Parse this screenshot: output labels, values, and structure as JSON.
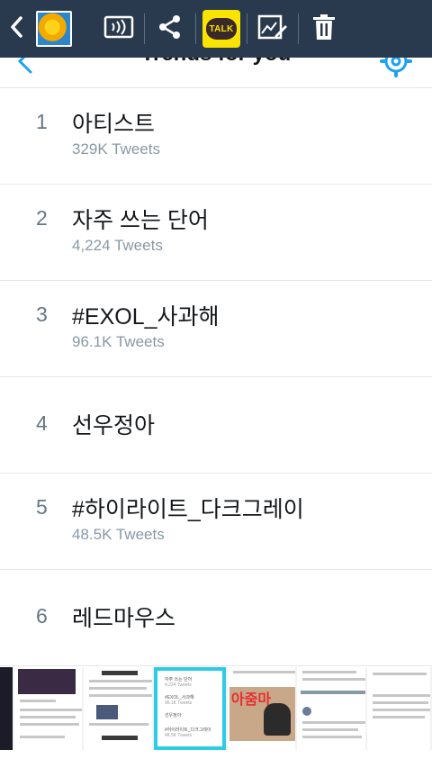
{
  "header": {
    "title": "Trends for you"
  },
  "trends": [
    {
      "rank": "1",
      "name": "아티스트",
      "count": "329K Tweets"
    },
    {
      "rank": "2",
      "name": "자주 쓰는 단어",
      "count": "4,224 Tweets"
    },
    {
      "rank": "3",
      "name": "#EXOL_사과해",
      "count": "96.1K Tweets"
    },
    {
      "rank": "4",
      "name": "선우정아",
      "count": ""
    },
    {
      "rank": "5",
      "name": "#하이라이트_다크그레이",
      "count": "48.5K Tweets"
    },
    {
      "rank": "6",
      "name": "레드마우스",
      "count": ""
    }
  ],
  "toolbar": {
    "talk_label": "TALK",
    "icons": [
      "back-icon",
      "cast-icon",
      "share-icon",
      "kakaotalk-icon",
      "edit-icon",
      "delete-icon"
    ]
  },
  "filmstrip": {
    "selected_preview": {
      "rows": [
        {
          "rank": "2",
          "name": "자주 쓰는 단어",
          "count": "4,224 Tweets"
        },
        {
          "rank": "3",
          "name": "#EXOL_사과해",
          "count": "96.1K Tweets"
        },
        {
          "rank": "4",
          "name": "선우정아",
          "count": ""
        },
        {
          "rank": "5",
          "name": "#하이라이트_다크그레이",
          "count": "48.5K Tweets"
        }
      ]
    },
    "video_caption": "아줌마"
  },
  "colors": {
    "toolbar_bg": "#2a3a4e",
    "accent": "#1da1f2",
    "selection": "#2ccbe6",
    "kakao_yellow": "#fbe300"
  }
}
